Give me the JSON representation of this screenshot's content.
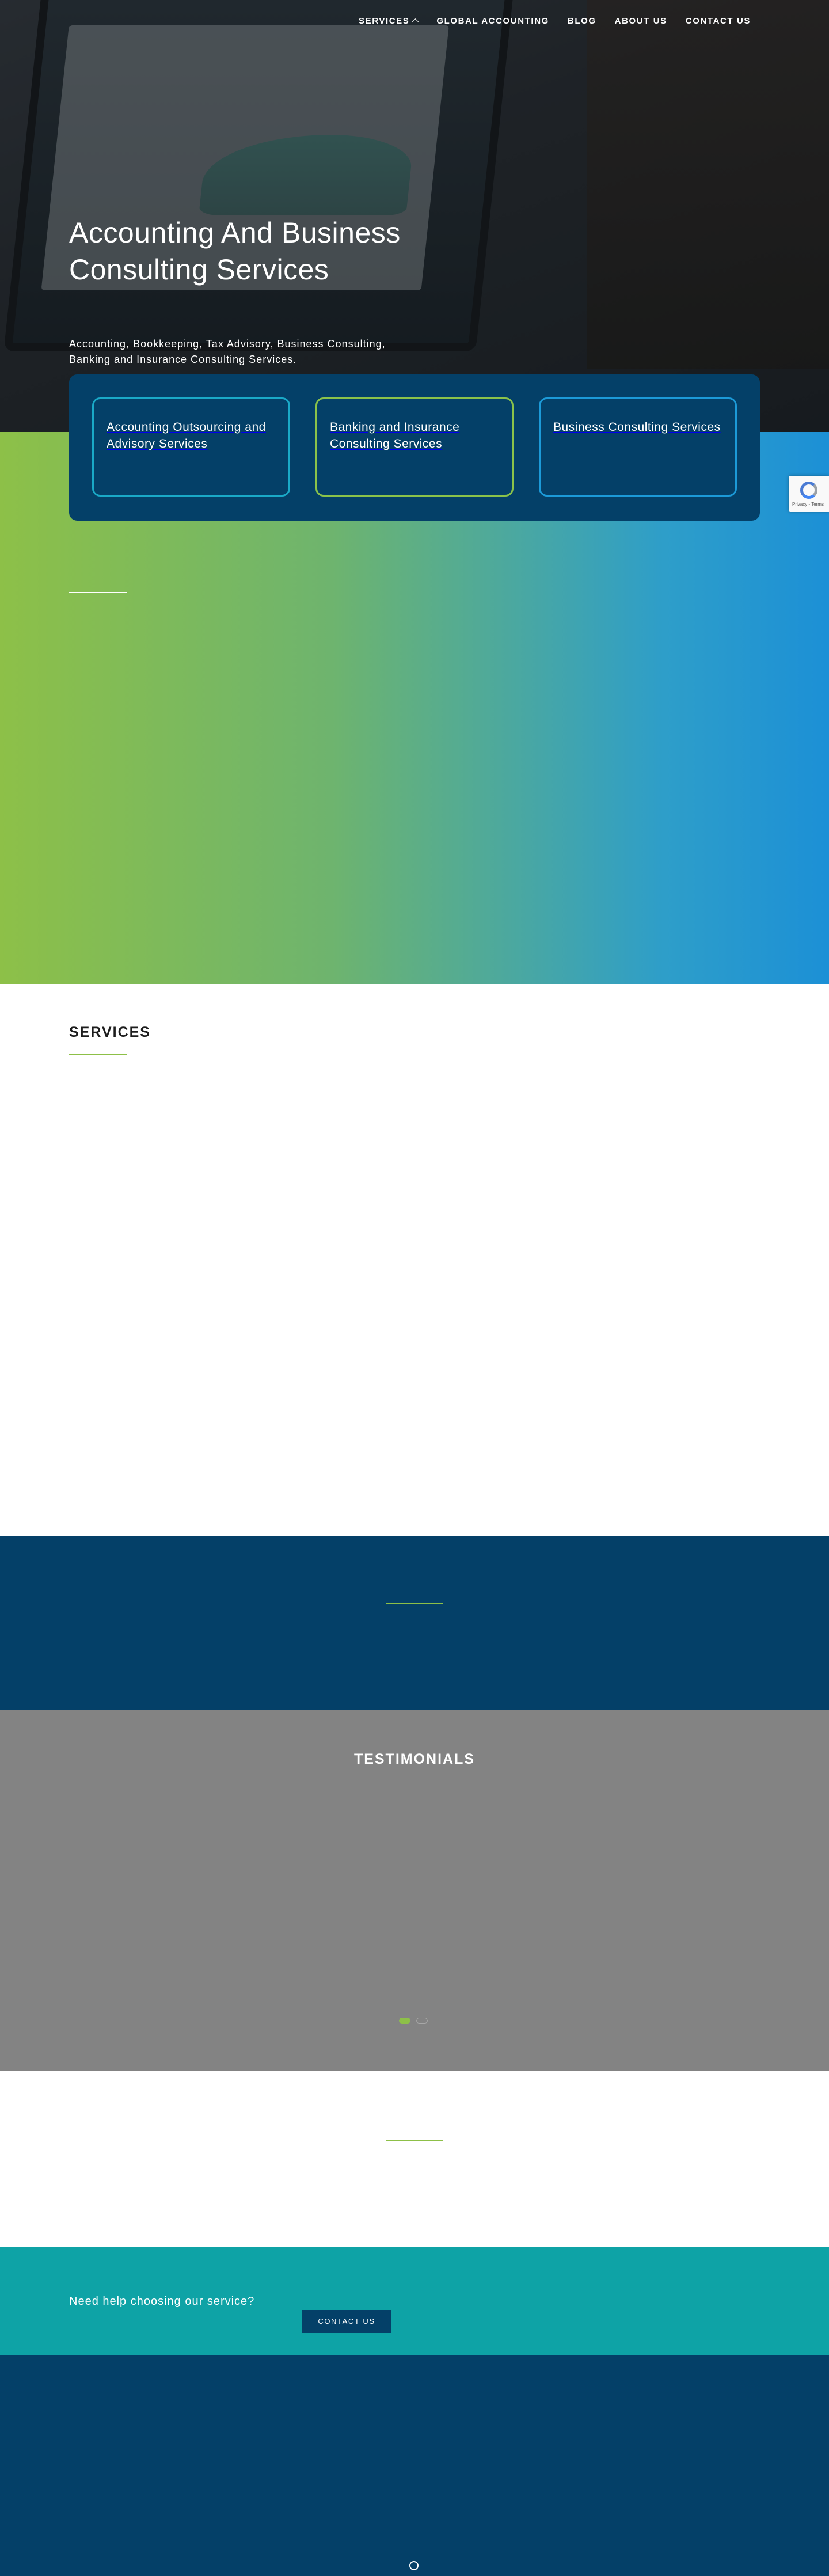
{
  "nav": {
    "items": [
      {
        "label": "SERVICES",
        "has_dropdown": true
      },
      {
        "label": "GLOBAL ACCOUNTING"
      },
      {
        "label": "BLOG"
      },
      {
        "label": "ABOUT US"
      },
      {
        "label": "CONTACT US"
      }
    ]
  },
  "hero": {
    "title": "Accounting And Business Consulting Services",
    "subtitle": "Accounting, Bookkeeping, Tax Advisory, Business Consulting, Banking and Insurance Consulting Services."
  },
  "cards": [
    {
      "label": "Accounting Outsourcing and Advisory Services",
      "border_color": "#1aa9c7"
    },
    {
      "label": "Banking and Insurance Consulting Services",
      "border_color": "#8bc34a"
    },
    {
      "label": "Business Consulting Services",
      "border_color": "#1c9ad8"
    }
  ],
  "recaptcha": {
    "text": "Privacy - Terms"
  },
  "services": {
    "title": "SERVICES"
  },
  "testimonials": {
    "title": "TESTIMONIALS",
    "slide_count": 2,
    "active_slide": 1
  },
  "cta": {
    "text": "Need help choosing our service?",
    "button_label": "CONTACT US"
  },
  "colors": {
    "navy": "#044068",
    "green_accent": "#8dc048",
    "teal": "#0ea3a6",
    "grey": "#838383",
    "gradient_start": "#8dc048",
    "gradient_end": "#1c90d6"
  },
  "icons": {
    "scroll_top": "circle-icon",
    "dropdown": "chevron-down-icon"
  }
}
